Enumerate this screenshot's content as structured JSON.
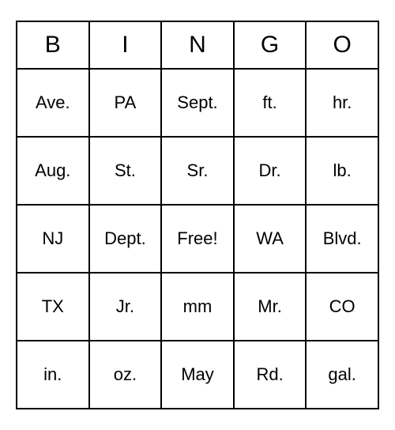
{
  "bingo": {
    "headers": [
      "B",
      "I",
      "N",
      "G",
      "O"
    ],
    "rows": [
      [
        "Ave.",
        "PA",
        "Sept.",
        "ft.",
        "hr."
      ],
      [
        "Aug.",
        "St.",
        "Sr.",
        "Dr.",
        "lb."
      ],
      [
        "NJ",
        "Dept.",
        "Free!",
        "WA",
        "Blvd."
      ],
      [
        "TX",
        "Jr.",
        "mm",
        "Mr.",
        "CO"
      ],
      [
        "in.",
        "oz.",
        "May",
        "Rd.",
        "gal."
      ]
    ]
  }
}
